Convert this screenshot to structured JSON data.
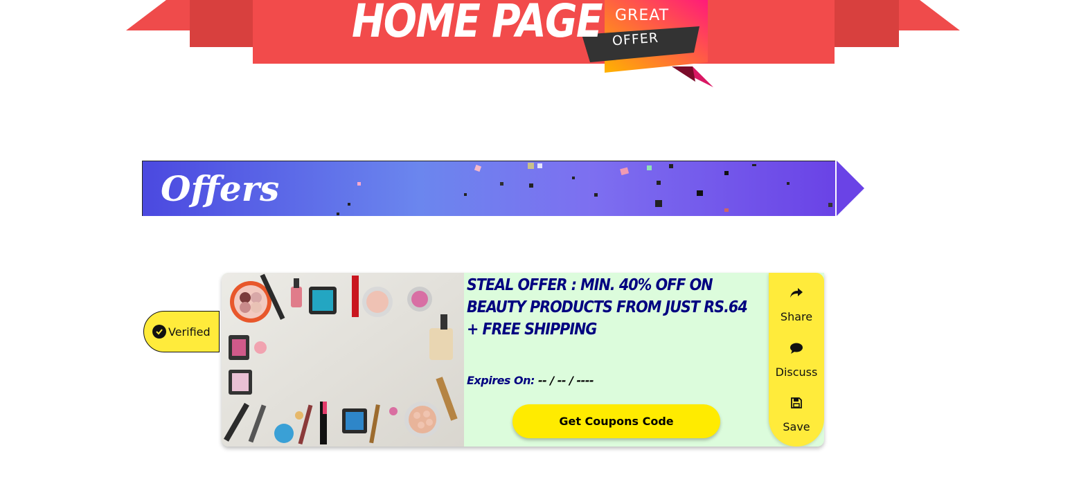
{
  "header": {
    "title": "HOME PAGE",
    "badge_top": "GREAT",
    "badge_bottom": "OFFER"
  },
  "section": {
    "title": "Offers"
  },
  "offer": {
    "verified_label": "Verified",
    "title": "Steal Offer : Min. 40% off on Beauty products from just Rs.64 + Free Shipping",
    "expires_label": "Expires On:",
    "expires_value": "-- / -- / ----",
    "cta_label": "Get Coupons Code",
    "image_description_icon": "cosmetics-photo",
    "actions": [
      {
        "label": "Share",
        "icon": "share-icon"
      },
      {
        "label": "Discuss",
        "icon": "comment-icon"
      },
      {
        "label": "Save",
        "icon": "floppy-disk-icon"
      }
    ]
  },
  "colors": {
    "ribbon_red": "#ef4b4b",
    "offers_blue": "#5a6be8",
    "card_green": "#dcfcdc",
    "accent_yellow": "#ffeb3b",
    "title_navy": "#000080"
  }
}
